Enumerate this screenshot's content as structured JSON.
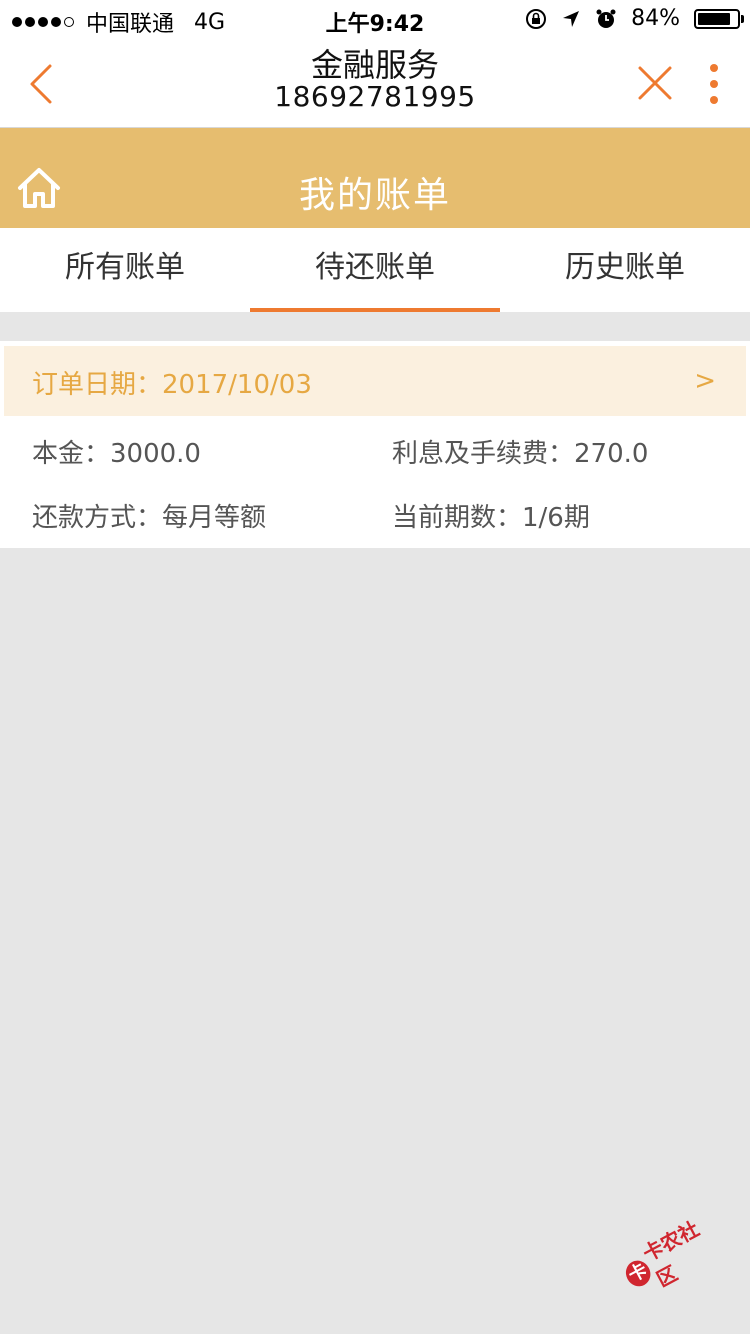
{
  "statusbar": {
    "carrier": "中国联通",
    "network": "4G",
    "time": "上午9:42",
    "battery_percent": "84%",
    "battery_level": 0.84
  },
  "navbar": {
    "title": "金融服务",
    "subtitle": "18692781995"
  },
  "header": {
    "title": "我的账单"
  },
  "tabs": [
    {
      "label": "所有账单",
      "active": false
    },
    {
      "label": "待还账单",
      "active": true
    },
    {
      "label": "历史账单",
      "active": false
    }
  ],
  "bill": {
    "date_label": "订单日期：2017/10/03",
    "arrow": ">",
    "principal": "本金：3000.0",
    "interest": "利息及手续费：270.0",
    "repay_method": "还款方式：每月等额",
    "period": "当前期数：1/6期"
  },
  "watermark": {
    "mark": "卡",
    "text": "卡农社区"
  },
  "colors": {
    "accent": "#ee7a30",
    "band": "#e6bd6f",
    "date": "#e6a843"
  },
  "icons": {
    "back": "chevron-left-icon",
    "close": "close-icon",
    "more": "more-vertical-icon",
    "home": "home-icon"
  }
}
